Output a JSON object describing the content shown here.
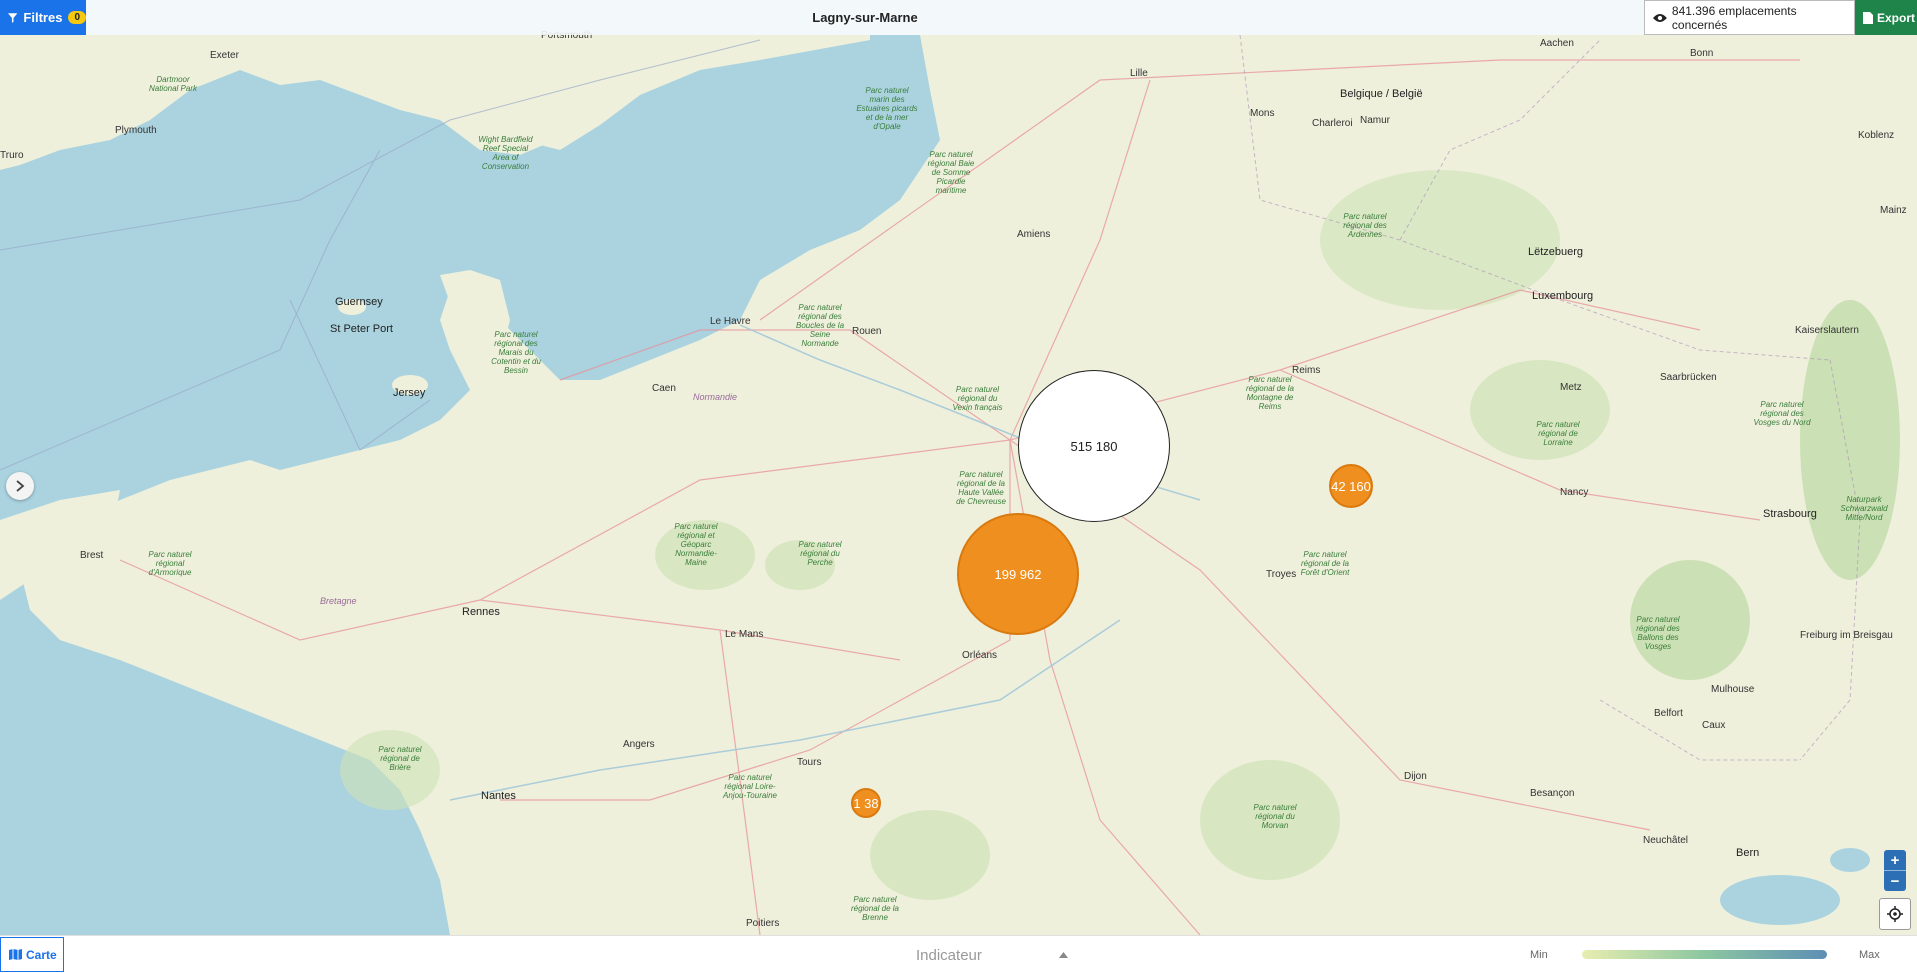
{
  "header": {
    "filters_label": "Filtres",
    "filters_count": "0",
    "title": "Lagny-sur-Marne",
    "count_text": "841.396 emplacements concernés",
    "export_label": "Export"
  },
  "map": {
    "bubbles": [
      {
        "value": "515 180",
        "style": "white"
      },
      {
        "value": "199 962",
        "style": "orange"
      },
      {
        "value": "42 160",
        "style": "orange"
      },
      {
        "value": "1 38",
        "style": "orange"
      }
    ],
    "places": {
      "portsmouth": "Portsmouth",
      "exeter": "Exeter",
      "plymouth": "Plymouth",
      "truro": "Truro",
      "guernsey": "Guernsey",
      "st_peter_port": "St Peter Port",
      "jersey": "Jersey",
      "caen": "Caen",
      "le_havre": "Le Havre",
      "rouen": "Rouen",
      "amiens": "Amiens",
      "lille": "Lille",
      "reims": "Reims",
      "brest": "Brest",
      "rennes": "Rennes",
      "le_mans": "Le Mans",
      "orleans": "Orléans",
      "tours": "Tours",
      "angers": "Angers",
      "nantes": "Nantes",
      "poitiers": "Poitiers",
      "troyes": "Troyes",
      "nancy": "Nancy",
      "metz": "Metz",
      "strasbourg": "Strasbourg",
      "dijon": "Dijon",
      "besancon": "Besançon",
      "mulhouse": "Mulhouse",
      "belfort": "Belfort",
      "bern": "Bern",
      "freiburg": "Freiburg im Breisgau",
      "luxembourg": "Luxembourg",
      "letzeburg": "Lëtzebuerg",
      "belgique": "Belgique / België",
      "namur": "Namur",
      "mons": "Mons",
      "charleroi": "Charleroi",
      "aachen": "Aachen",
      "bonn": "Bonn",
      "koblenz": "Koblenz",
      "mainz": "Mainz",
      "saarbrucken": "Saarbrücken",
      "kaiserslautern": "Kaiserslautern",
      "neuchatel": "Neuchâtel",
      "caux": "Caux"
    },
    "regions": {
      "bretagne": "Bretagne",
      "normandie": "Normandie"
    },
    "parks": {
      "armorique": "Parc naturel régional d'Armorique",
      "brenne": "Parc naturel régional de la Brenne",
      "loire_anjou": "Parc naturel régional Loire-Anjou-Touraine",
      "morvan": "Parc naturel régional du Morvan",
      "perche": "Parc naturel régional du Perche",
      "normandie_maine": "Parc naturel régional et Géoparc Normandie-Maine",
      "vosges_nord": "Parc naturel régional des Vosges du Nord",
      "lorraine": "Parc naturel régional de Lorraine",
      "ballons": "Parc naturel régional des Ballons des Vosges",
      "foret_orient": "Parc naturel régional de la Forêt d'Orient",
      "montagne_reims": "Parc naturel régional de la Montagne de Reims",
      "ardennes": "Parc naturel régional des Ardennes",
      "boucles_seine": "Parc naturel régional des Boucles de la Seine Normande",
      "marais_cotentin": "Parc naturel régional des Marais du Cotentin et du Bessin",
      "vexin": "Parc naturel régional du Vexin français",
      "estuaires": "Parc naturel marin des Estuaires picards et de la mer d'Opale",
      "briere": "Parc naturel régional de Brière",
      "chevreuse": "Parc naturel régional de la Haute Vallée de Chevreuse",
      "somme": "Parc naturel régional Baie de Somme Picardie maritime",
      "schwarzwald": "Naturpark Schwarzwald Mitte/Nord",
      "dartmoor": "Dartmoor National Park",
      "wight": "Wight Bardfield Reef Special Area of Conservation"
    }
  },
  "footer": {
    "carte_label": "Carte",
    "indicator_placeholder": "Indicateur",
    "legend_min": "Min",
    "legend_max": "Max"
  },
  "colors": {
    "primary": "#1a73e8",
    "export": "#1e8449",
    "bubble_orange": "#ef8f1f",
    "badge": "#f6c90e",
    "sea": "#aad3df",
    "land": "#eef0dc"
  }
}
